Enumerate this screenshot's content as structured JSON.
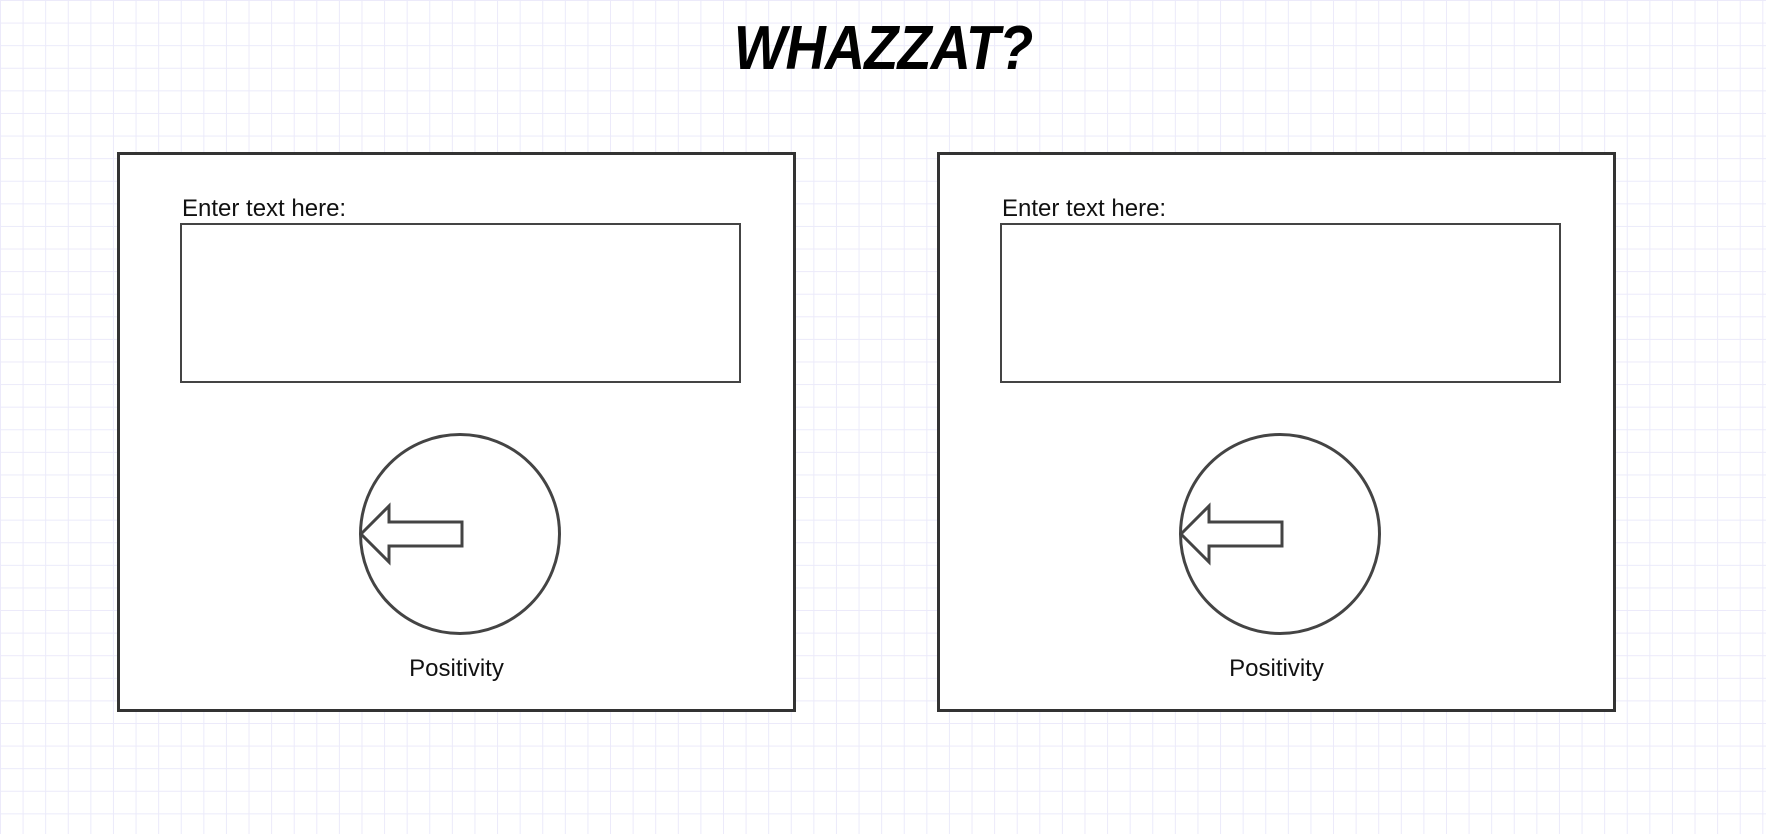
{
  "header": {
    "title": "WHAZZAT?"
  },
  "panels": [
    {
      "field_label": "Enter text here:",
      "text_value": "",
      "button_icon": "left-arrow-icon",
      "caption": "Positivity"
    },
    {
      "field_label": "Enter text here:",
      "text_value": "",
      "button_icon": "left-arrow-icon",
      "caption": "Positivity"
    }
  ],
  "colors": {
    "grid_line": "#ebeafa",
    "border": "#333333",
    "text": "#111111"
  }
}
